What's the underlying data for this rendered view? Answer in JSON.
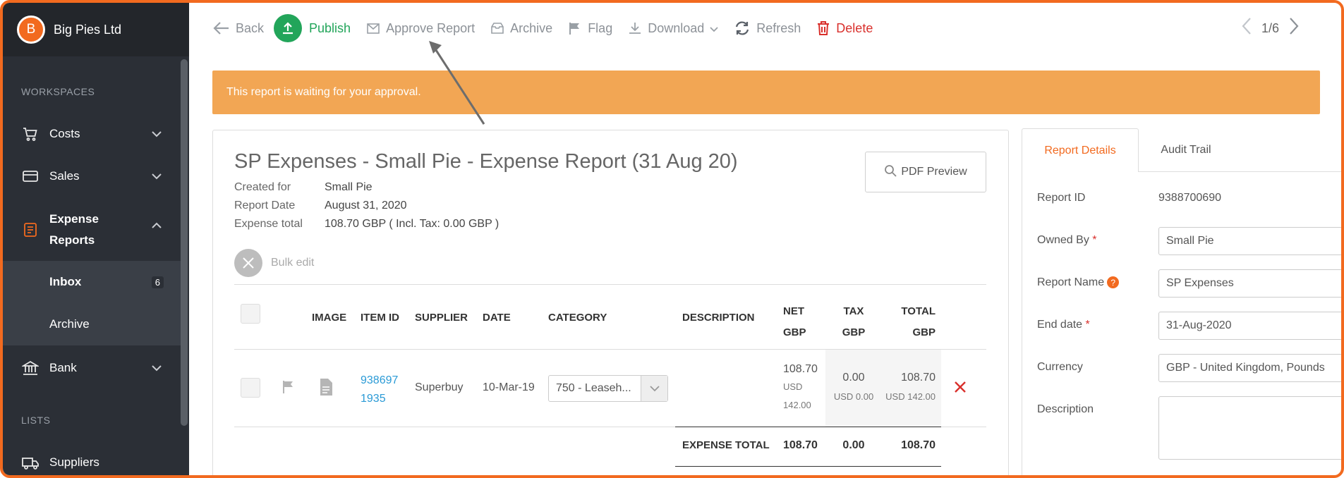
{
  "sidebar": {
    "avatar_letter": "B",
    "company": "Big Pies Ltd",
    "section_workspaces": "WORKSPACES",
    "items": {
      "costs": "Costs",
      "sales": "Sales",
      "expense_reports_1": "Expense",
      "expense_reports_2": "Reports",
      "bank": "Bank",
      "suppliers": "Suppliers"
    },
    "sub": {
      "inbox": "Inbox",
      "inbox_count": "6",
      "archive": "Archive"
    },
    "section_lists": "LISTS"
  },
  "toolbar": {
    "back": "Back",
    "publish": "Publish",
    "approve": "Approve Report",
    "archive": "Archive",
    "flag": "Flag",
    "download": "Download",
    "refresh": "Refresh",
    "delete": "Delete",
    "pager": "1/6"
  },
  "alert": {
    "message": "This report is waiting for your approval."
  },
  "report": {
    "title": "SP Expenses - Small Pie - Expense Report (31 Aug 20)",
    "created_for_label": "Created for",
    "created_for": "Small Pie",
    "report_date_label": "Report Date",
    "report_date": "August 31, 2020",
    "expense_total_label": "Expense total",
    "expense_total": "108.70 GBP ( Incl. Tax: 0.00 GBP )",
    "pdf_preview": "PDF Preview",
    "bulk_edit": "Bulk edit"
  },
  "table": {
    "headers": {
      "image": "IMAGE",
      "item_id": "ITEM ID",
      "supplier": "SUPPLIER",
      "date": "DATE",
      "category": "CATEGORY",
      "description": "DESCRIPTION",
      "net_1": "NET",
      "net_2": "GBP",
      "tax_1": "TAX",
      "tax_2": "GBP",
      "total_1": "TOTAL",
      "total_2": "GBP"
    },
    "row": {
      "item_id_1": "938697",
      "item_id_2": "1935",
      "supplier": "Superbuy",
      "date": "10-Mar-19",
      "category": "750 - Leaseh...",
      "net": "108.70",
      "net_usd_1": "USD",
      "net_usd_2": "142.00",
      "tax": "0.00",
      "tax_usd": "USD 0.00",
      "total": "108.70",
      "total_usd": "USD 142.00"
    },
    "footer": {
      "label": "EXPENSE TOTAL",
      "net": "108.70",
      "tax": "0.00",
      "total": "108.70"
    }
  },
  "panel": {
    "tab_details": "Report Details",
    "tab_audit": "Audit Trail",
    "report_id_label": "Report ID",
    "report_id": "9388700690",
    "owned_by_label": "Owned By",
    "owned_by": "Small Pie",
    "report_name_label": "Report Name",
    "report_name": "SP Expenses",
    "end_date_label": "End date",
    "end_date": "31-Aug-2020",
    "currency_label": "Currency",
    "currency": "GBP - United Kingdom, Pounds",
    "description_label": "Description",
    "req_mark": "*",
    "help_mark": "?"
  }
}
